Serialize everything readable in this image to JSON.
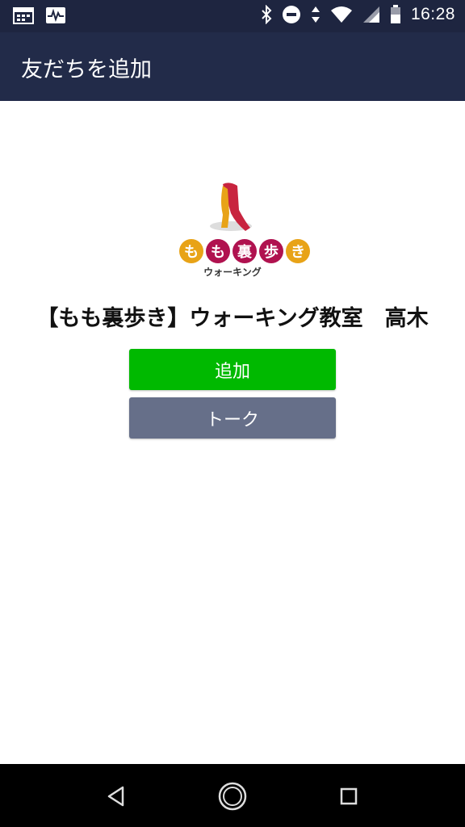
{
  "status_bar": {
    "time": "16:28",
    "left_icons": [
      "calendar-icon",
      "activity-icon"
    ],
    "right_icons": [
      "bluetooth-icon",
      "do-not-disturb-icon",
      "data-arrows-icon",
      "wifi-icon",
      "signal-icon",
      "battery-icon"
    ]
  },
  "app_bar": {
    "title": "友だちを追加"
  },
  "logo": {
    "chars": [
      "も",
      "も",
      "裏",
      "歩",
      "き"
    ],
    "char_colors": [
      "#e8a317",
      "#b0124f",
      "#b0124f",
      "#b0124f",
      "#e8a317"
    ],
    "subtitle": "ウォーキング"
  },
  "account": {
    "name": "【もも裏歩き】ウォーキング教室　高木"
  },
  "buttons": {
    "add_label": "追加",
    "talk_label": "トーク"
  },
  "colors": {
    "status_bar": "#1e2540",
    "app_bar": "#222b49",
    "add_button": "#00b900",
    "talk_button": "#666f89"
  },
  "nav_bar": {
    "buttons": [
      "back-icon",
      "home-icon",
      "recents-icon"
    ]
  }
}
